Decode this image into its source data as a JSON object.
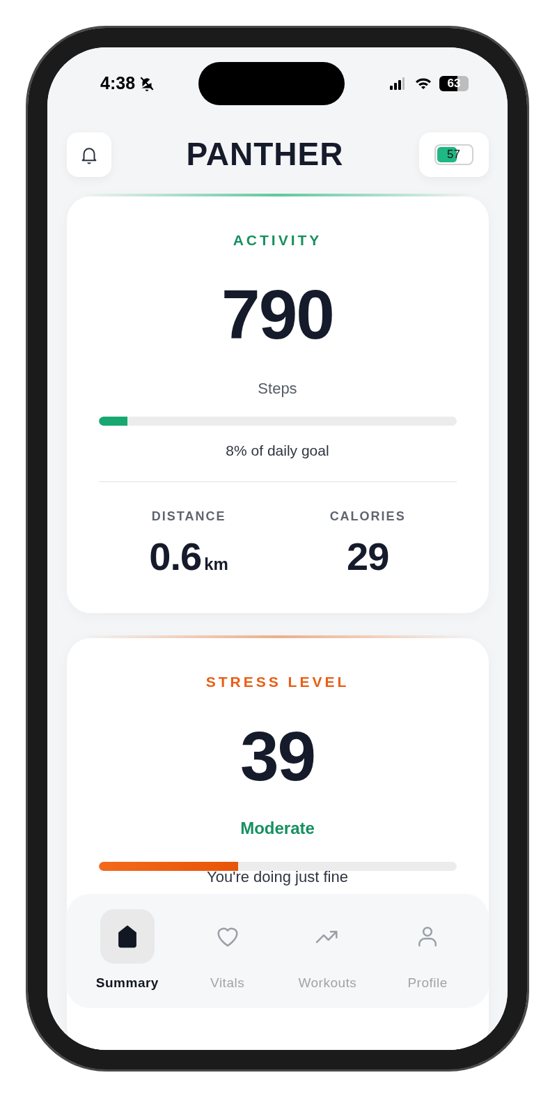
{
  "status_bar": {
    "time": "4:38",
    "silent": true,
    "battery": "63"
  },
  "header": {
    "title": "PANTHER",
    "device_battery": "57"
  },
  "activity": {
    "title": "ACTIVITY",
    "value": "790",
    "unit": "Steps",
    "goal": {
      "level": 0.08,
      "text": "8% of daily goal"
    },
    "metrics": [
      {
        "label": "DISTANCE",
        "value": "0.6",
        "unit": "km"
      },
      {
        "label": "CALORIES",
        "value": "29"
      }
    ]
  },
  "stress": {
    "title": "STRESS LEVEL",
    "value": "39",
    "status": "Moderate",
    "level": 0.39,
    "message": "You're doing just fine"
  },
  "tabs": [
    {
      "label": "Summary",
      "selected": true
    },
    {
      "label": "Vitals",
      "selected": false
    },
    {
      "label": "Workouts",
      "selected": false
    },
    {
      "label": "Profile",
      "selected": false
    }
  ]
}
